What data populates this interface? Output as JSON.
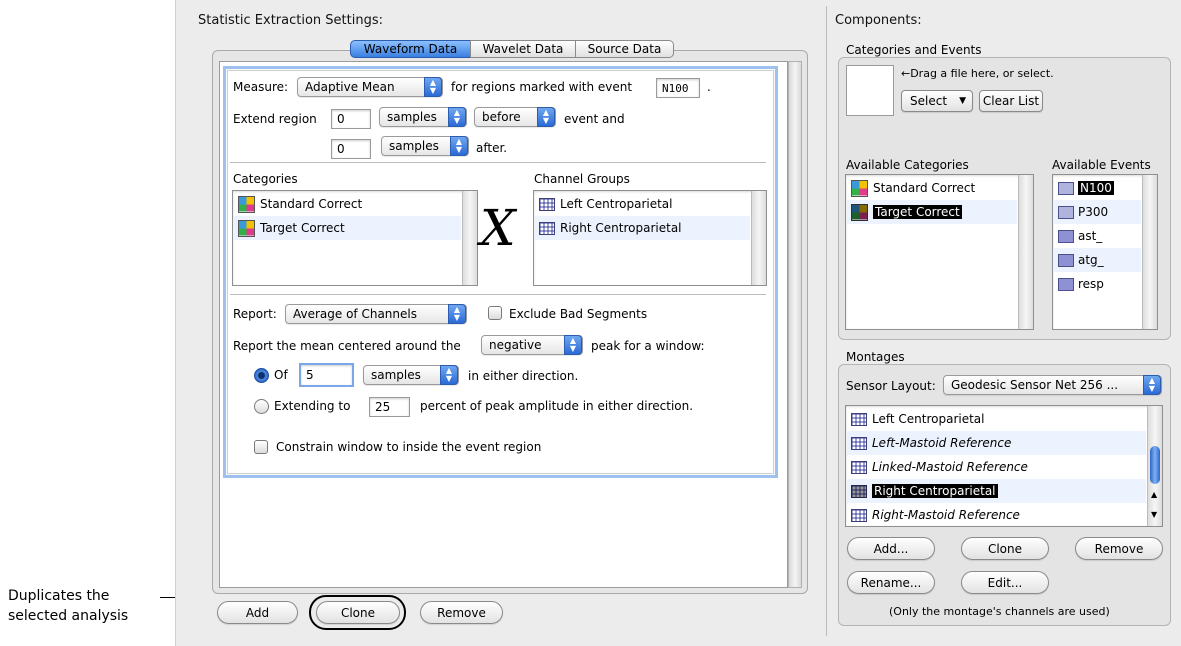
{
  "annotation": {
    "line1": "Duplicates the",
    "line2": "selected analysis"
  },
  "settings": {
    "title": "Statistic Extraction Settings:",
    "tabs": [
      "Waveform Data",
      "Wavelet Data",
      "Source Data"
    ],
    "measure_label": "Measure:",
    "measure_value": "Adaptive Mean",
    "regions_text": "for regions marked with event",
    "event_value": "N100",
    "period": ".",
    "extend_label": "Extend region",
    "extend_before_value": "0",
    "units_value": "samples",
    "before_value": "before",
    "event_and": "event and",
    "extend_after_value": "0",
    "after_text": "after.",
    "categories_label": "Categories",
    "categories": [
      "Standard Correct",
      "Target Correct"
    ],
    "cross_symbol": "X",
    "channel_groups_label": "Channel Groups",
    "channel_groups": [
      "Left Centroparietal",
      "Right Centroparietal"
    ],
    "report_label": "Report:",
    "report_value": "Average of Channels",
    "exclude_label": "Exclude Bad Segments",
    "mean_text": "Report the mean centered around the",
    "peak_value": "negative",
    "peak_text": "peak for a window:",
    "of_label": "Of",
    "of_value": "5",
    "of_units": "samples",
    "either_text": "in either direction.",
    "extending_label": "Extending to",
    "extending_value": "25",
    "percent_text": "percent of peak amplitude in either direction.",
    "constrain_label": "Constrain window to inside the event region",
    "add_label": "Add",
    "clone_label": "Clone",
    "remove_label": "Remove"
  },
  "components": {
    "title": "Components:",
    "cat_events_label": "Categories and Events",
    "drag_text": "←Drag a file here, or select.",
    "select_label": "Select",
    "clear_label": "Clear List",
    "avail_categories_label": "Available Categories",
    "avail_categories": [
      "Standard Correct",
      "Target Correct"
    ],
    "avail_events_label": "Available Events",
    "avail_events": [
      "N100",
      "P300",
      "ast_",
      "atg_",
      "resp"
    ],
    "montages_label": "Montages",
    "sensor_label": "Sensor Layout:",
    "sensor_value": "Geodesic Sensor Net 256 ...",
    "montages": [
      "Left Centroparietal",
      "Left-Mastoid Reference",
      "Linked-Mastoid Reference",
      "Right Centroparietal",
      "Right-Mastoid Reference"
    ],
    "add_label": "Add...",
    "clone_label": "Clone",
    "remove_label": "Remove",
    "rename_label": "Rename...",
    "edit_label": "Edit...",
    "note": "(Only the montage's channels are used)"
  },
  "colors": {
    "accent": "#3a7fe0",
    "selection": "#000000",
    "panel_bg": "#ececec",
    "alt_row": "#edf3fe"
  }
}
